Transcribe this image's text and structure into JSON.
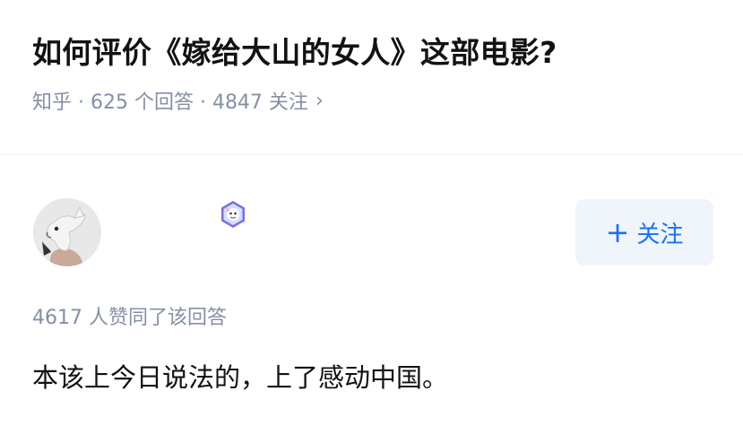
{
  "question": {
    "title": "如何评价《嫁给大山的女人》这部电影?",
    "meta": "知乎 · 625 个回答 · 4847 关注",
    "chevron_icon": "chevron-right-icon"
  },
  "answer": {
    "author": {
      "name": "",
      "avatar_icon": "horse-mask-avatar",
      "badge_icon": "creator-badge-icon"
    },
    "follow_label": "关注",
    "follow_icon": "plus-icon",
    "vote_text": "4617 人赞同了该回答",
    "content": "本该上今日说法的，上了感动中国。"
  },
  "colors": {
    "accent": "#1772f6",
    "meta_gray": "#8590a6",
    "button_bg": "#f0f4fb",
    "text": "#121212"
  }
}
